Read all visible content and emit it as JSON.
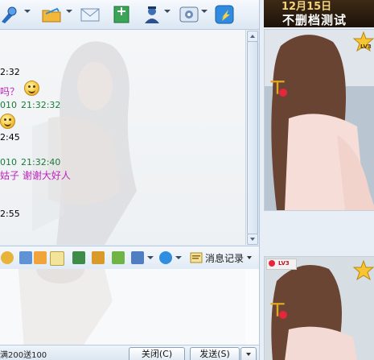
{
  "toolbar": {
    "icons": [
      "microphone-icon",
      "folder-icon",
      "mail-icon",
      "add-document-icon",
      "user-services-icon",
      "settings-icon",
      "app-launcher-icon"
    ]
  },
  "chat": {
    "line_time_1": "2:32",
    "line_question": "吗？",
    "line_time_2a": "010",
    "line_time_2b": "21:32:32",
    "line_time_3": "2:45",
    "line_time_4a": "010",
    "line_time_4b": "21:32:40",
    "line_text_4": "姑子  谢谢大好人",
    "line_time_5": "2:55"
  },
  "input_toolbar": {
    "icons": [
      "emoticon-icon",
      "bucket-icon",
      "edit-pen-icon",
      "picture-icon",
      "screenshot-icon",
      "gift-icon",
      "screen-share-icon",
      "music-icon"
    ],
    "history_label": "消息记录"
  },
  "bottom": {
    "counter": "满200送100",
    "close_label": "关闭(C)",
    "send_label": "发送(S)"
  },
  "ad": {
    "date": "12月15日",
    "slogan": "不删档测试"
  },
  "show": {
    "level_top": "LV3",
    "level_bottom": "LV3"
  },
  "colors": {
    "timestamp": "#1b7a3a",
    "message_text": "#c020c0",
    "ad_gold": "#f4d27b"
  }
}
